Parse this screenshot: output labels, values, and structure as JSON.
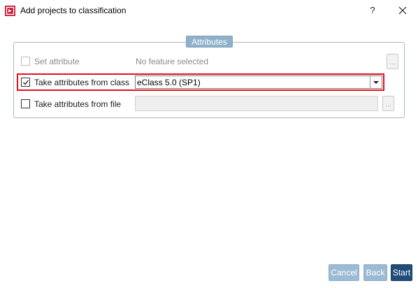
{
  "window": {
    "title": "Add projects to classification",
    "help_label": "?",
    "app_icon": "cadenas-app-icon",
    "accent_color": "#c8102e"
  },
  "group": {
    "title": "Attributes"
  },
  "rows": {
    "set_attribute": {
      "label": "Set attribute",
      "value": "No feature selected",
      "checked": false,
      "enabled": false
    },
    "from_class": {
      "label": "Take attributes from class",
      "value": "eClass 5.0 (SP1)",
      "checked": true,
      "enabled": true,
      "highlight_color": "#e4121b"
    },
    "from_file": {
      "label": "Take attributes from file",
      "value": "",
      "checked": false,
      "enabled": false
    }
  },
  "browse_label": "...",
  "footer": {
    "cancel_label": "Cancel",
    "back_label": "Back",
    "start_label": "Start",
    "primary_color": "#1f4e79",
    "disabled_color": "#9bbad3"
  }
}
